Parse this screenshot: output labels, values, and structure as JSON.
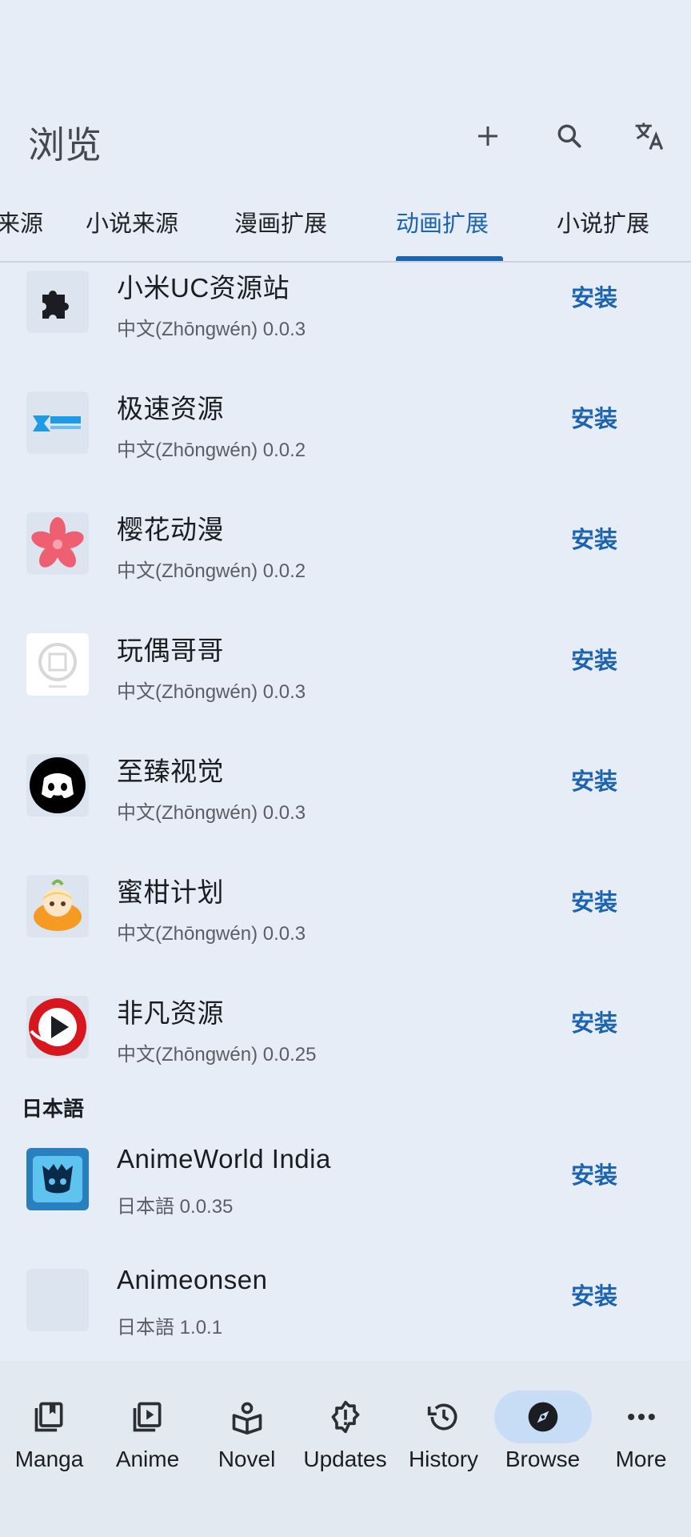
{
  "header": {
    "title": "浏览",
    "tabs": [
      {
        "label": "来源",
        "active": false
      },
      {
        "label": "小说来源",
        "active": false
      },
      {
        "label": "漫画扩展",
        "active": false
      },
      {
        "label": "动画扩展",
        "active": true
      },
      {
        "label": "小说扩展",
        "active": false
      }
    ],
    "actions": [
      "add-icon",
      "search-icon",
      "translate-icon"
    ]
  },
  "colors": {
    "accent": "#1c63b0",
    "background": "#e6edf7",
    "active_nav_pill": "#c7dcf5"
  },
  "list": {
    "install_label": "安装",
    "zh_items": [
      {
        "name": "小米UC资源站",
        "lang": "中文(Zhōngwén)",
        "version": "0.0.3",
        "icon": "puzzle-icon"
      },
      {
        "name": "极速资源",
        "lang": "中文(Zhōngwén)",
        "version": "0.0.2",
        "icon": "jisu-logo-icon"
      },
      {
        "name": "樱花动漫",
        "lang": "中文(Zhōngwén)",
        "version": "0.0.2",
        "icon": "sakura-flower-icon"
      },
      {
        "name": "玩偶哥哥",
        "lang": "中文(Zhōngwén)",
        "version": "0.0.3",
        "icon": "wanou-stamp-icon"
      },
      {
        "name": "至臻视觉",
        "lang": "中文(Zhōngwén)",
        "version": "0.0.3",
        "icon": "discord-like-icon"
      },
      {
        "name": "蜜柑计划",
        "lang": "中文(Zhōngwén)",
        "version": "0.0.3",
        "icon": "mikan-girl-icon"
      },
      {
        "name": "非凡资源",
        "lang": "中文(Zhōngwén)",
        "version": "0.0.25",
        "icon": "play-circle-icon"
      }
    ],
    "section_ja": "日本語",
    "ja_items": [
      {
        "name": "AnimeWorld India",
        "lang": "日本語",
        "version": "0.0.35",
        "icon": "animeworld-icon"
      },
      {
        "name": "Animeonsen",
        "lang": "日本語",
        "version": "1.0.1",
        "icon": "blank-icon"
      }
    ]
  },
  "bottom_nav": [
    {
      "label": "Manga",
      "icon": "manga-book-icon",
      "active": false
    },
    {
      "label": "Anime",
      "icon": "anime-play-icon",
      "active": false
    },
    {
      "label": "Novel",
      "icon": "novel-reader-icon",
      "active": false
    },
    {
      "label": "Updates",
      "icon": "updates-alert-icon",
      "active": false
    },
    {
      "label": "History",
      "icon": "history-icon",
      "active": false
    },
    {
      "label": "Browse",
      "icon": "compass-icon",
      "active": true
    },
    {
      "label": "More",
      "icon": "more-dots-icon",
      "active": false
    }
  ]
}
